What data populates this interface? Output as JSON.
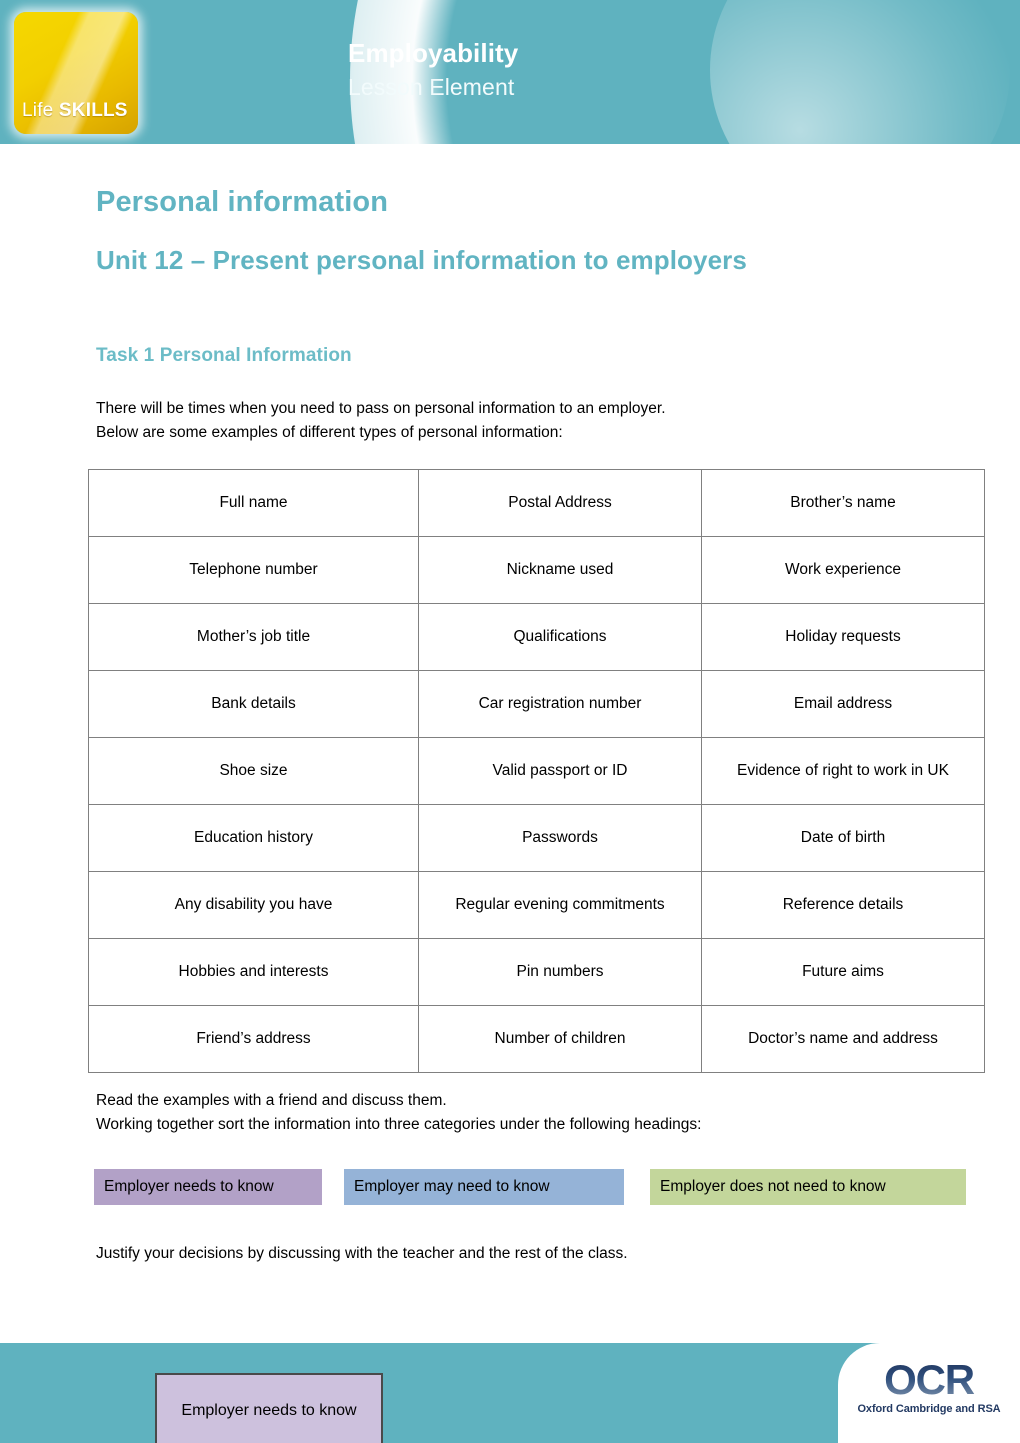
{
  "header": {
    "title": "Employability",
    "subtitle": "Lesson Element",
    "logo": {
      "line_light": "Life ",
      "line_bold": "SKILLS"
    }
  },
  "document": {
    "h1": "Personal information",
    "h2": "Unit 12 – Present personal information to employers",
    "h3": "Task 1 Personal Information",
    "intro_line1": "There will be times when you need to pass on personal information to an employer.",
    "intro_line2": "Below are some examples of different types of personal information:",
    "post_line1": "Read the examples with a friend and discuss them.",
    "post_line2": "Working together sort the information into three categories under the following headings:",
    "justify_line": "Justify your decisions by discussing with the teacher and the rest of the class."
  },
  "table": {
    "rows": [
      {
        "c1": "Full name",
        "c2": "Postal Address",
        "c3": "Brother’s name"
      },
      {
        "c1": "Telephone number",
        "c2": "Nickname used",
        "c3": "Work experience"
      },
      {
        "c1": "Mother’s job title",
        "c2": "Qualifications",
        "c3": "Holiday requests"
      },
      {
        "c1": "Bank details",
        "c2": "Car registration number",
        "c3": "Email address"
      },
      {
        "c1": "Shoe size",
        "c2": "Valid passport or ID",
        "c3": "Evidence of right to work in UK"
      },
      {
        "c1": "Education history",
        "c2": "Passwords",
        "c3": "Date of birth"
      },
      {
        "c1": "Any disability you have",
        "c2": "Regular evening commitments",
        "c3": "Reference details"
      },
      {
        "c1": "Hobbies and interests",
        "c2": "Pin numbers",
        "c3": "Future aims"
      },
      {
        "c1": "Friend’s address",
        "c2": "Number of children",
        "c3": "Doctor’s name and address"
      }
    ]
  },
  "categories": [
    {
      "label": "Employer needs to know",
      "color": "#b2a1c7"
    },
    {
      "label": "Employer may need to know",
      "color": "#95b3d7"
    },
    {
      "label": "Employer does not need to know",
      "color": "#c3d69b"
    }
  ],
  "footer": {
    "chip_label": "Employer needs to know",
    "ocr_mark": "OCR",
    "ocr_strapline": "Oxford Cambridge and RSA"
  },
  "colors": {
    "brand_teal": "#5fb2bf",
    "heading_teal": "#61b4c2",
    "subheading_teal": "#6cbcc7",
    "logo_yellow": "#f2cf00",
    "table_border": "#808080",
    "chip_purple": "#cdc1dd",
    "ocr_navy": "#233a63"
  }
}
